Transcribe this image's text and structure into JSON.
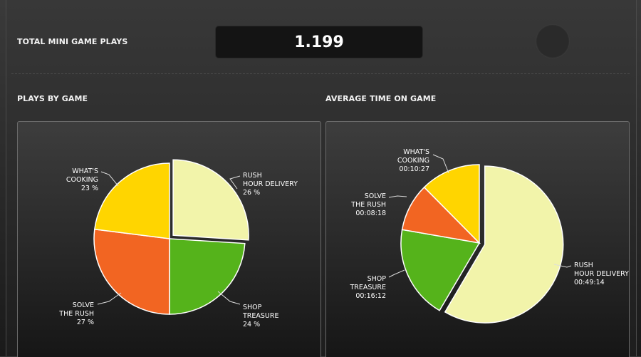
{
  "header": {
    "total_label": "TOTAL MINI GAME PLAYS",
    "total_value": "1.199"
  },
  "sections": {
    "plays_title": "PLAYS BY GAME",
    "avg_title": "AVERAGE TIME ON GAME"
  },
  "colors": {
    "rush_hour": "#f2f4aa",
    "shop_treasure": "#55b31b",
    "solve_rush": "#f26522",
    "whats_cooking": "#ffd500"
  },
  "chart_data": [
    {
      "type": "pie",
      "title": "PLAYS BY GAME",
      "slices": [
        {
          "label_lines": [
            "RUSH",
            "HOUR DELIVERY"
          ],
          "value": 26,
          "display": "26 %"
        },
        {
          "label_lines": [
            "SHOP",
            "TREASURE"
          ],
          "value": 24,
          "display": "24 %"
        },
        {
          "label_lines": [
            "SOLVE",
            "THE RUSH"
          ],
          "value": 27,
          "display": "27 %"
        },
        {
          "label_lines": [
            "WHAT'S",
            "COOKING"
          ],
          "value": 23,
          "display": "23 %"
        }
      ]
    },
    {
      "type": "pie",
      "title": "AVERAGE TIME ON GAME",
      "slices": [
        {
          "label_lines": [
            "RUSH",
            "HOUR DELIVERY"
          ],
          "value": 49.233,
          "display": "00:49:14"
        },
        {
          "label_lines": [
            "SHOP",
            "TREASURE"
          ],
          "value": 16.2,
          "display": "00:16:12"
        },
        {
          "label_lines": [
            "SOLVE",
            "THE RUSH"
          ],
          "value": 8.3,
          "display": "00:08:18"
        },
        {
          "label_lines": [
            "WHAT'S",
            "COOKING"
          ],
          "value": 10.45,
          "display": "00:10:27"
        }
      ]
    }
  ]
}
